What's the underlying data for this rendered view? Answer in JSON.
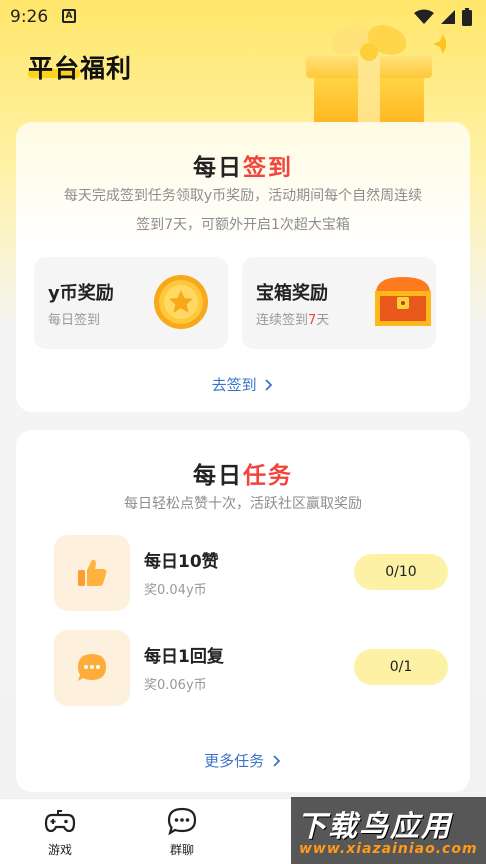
{
  "status_bar": {
    "time": "9:26",
    "notification_letter": "A"
  },
  "header": {
    "title": "平台福利"
  },
  "signin": {
    "title_part1": "每日",
    "title_part2": "签到",
    "description_line1": "每天完成签到任务领取y币奖励，活动期间每个自然周连续",
    "description_line2": "签到7天，可额外开启1次超大宝箱",
    "rewards": [
      {
        "title": "y币奖励",
        "subtitle": "每日签到"
      },
      {
        "title": "宝箱奖励",
        "subtitle_prefix": "连续签到",
        "subtitle_highlight": "7",
        "subtitle_suffix": "天"
      }
    ],
    "link_label": "去签到"
  },
  "tasks": {
    "title_part1": "每日",
    "title_part2": "任务",
    "description": "每日轻松点赞十次，活跃社区赢取奖励",
    "items": [
      {
        "title": "每日10赞",
        "reward": "奖0.04y币",
        "progress": "0/10",
        "icon": "thumbs-up-icon"
      },
      {
        "title": "每日1回复",
        "reward": "奖0.06y币",
        "progress": "0/1",
        "icon": "chat-bubble-icon"
      }
    ],
    "link_label": "更多任务"
  },
  "bottom_nav": [
    {
      "label": "游戏",
      "icon": "gamepad-icon"
    },
    {
      "label": "群聊",
      "icon": "chat-icon"
    }
  ],
  "watermark": {
    "main": "下载鸟应用",
    "url": "www.xiazainiao.com"
  },
  "colors": {
    "accent_red": "#f1453c",
    "brand_yellow": "#ffd21a",
    "link_blue": "#3b73c9",
    "progress_pill": "#fdf1a6"
  }
}
